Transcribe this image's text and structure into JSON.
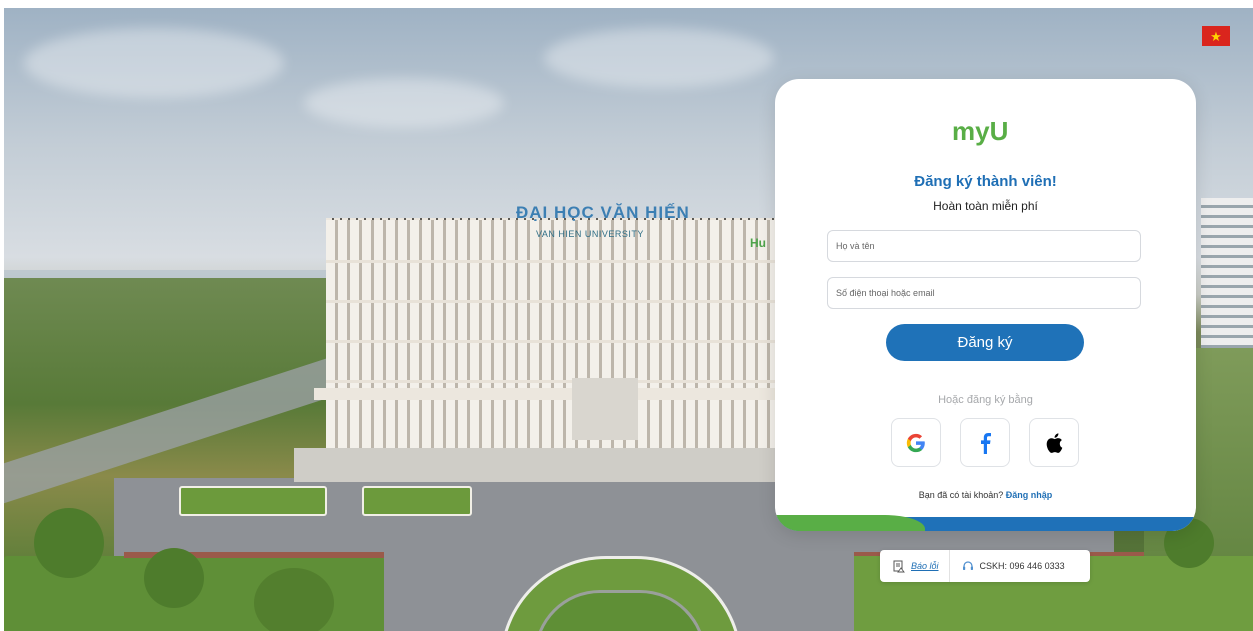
{
  "background": {
    "sign_main": "ĐẠI HỌC VĂN HIẾN",
    "sign_sub": "VAN HIEN UNIVERSITY",
    "sign_side": "Hu"
  },
  "language_flag": {
    "icon": "vietnam-flag-icon",
    "glyph": "★"
  },
  "card": {
    "logo_text": "myU",
    "title": "Đăng ký thành viên!",
    "subtitle": "Hoàn toàn miễn phí",
    "name_placeholder": "Họ và tên",
    "contact_placeholder": "Số điện thoại hoặc email",
    "register_button": "Đăng ký",
    "alt_signup_text": "Hoặc đăng ký bằng",
    "social": [
      {
        "name": "google",
        "icon": "google-icon"
      },
      {
        "name": "facebook",
        "icon": "facebook-icon"
      },
      {
        "name": "apple",
        "icon": "apple-icon"
      }
    ],
    "have_account_text": "Bạn đã có tài khoản?",
    "login_link": "Đăng nhập"
  },
  "support": {
    "report_label": "Báo lỗi",
    "hotline": "CSKH: 096 446 0333"
  },
  "colors": {
    "brand_blue": "#1f72b8",
    "brand_green": "#59ae46",
    "flag_red": "#da251d",
    "flag_star": "#ffd200"
  }
}
